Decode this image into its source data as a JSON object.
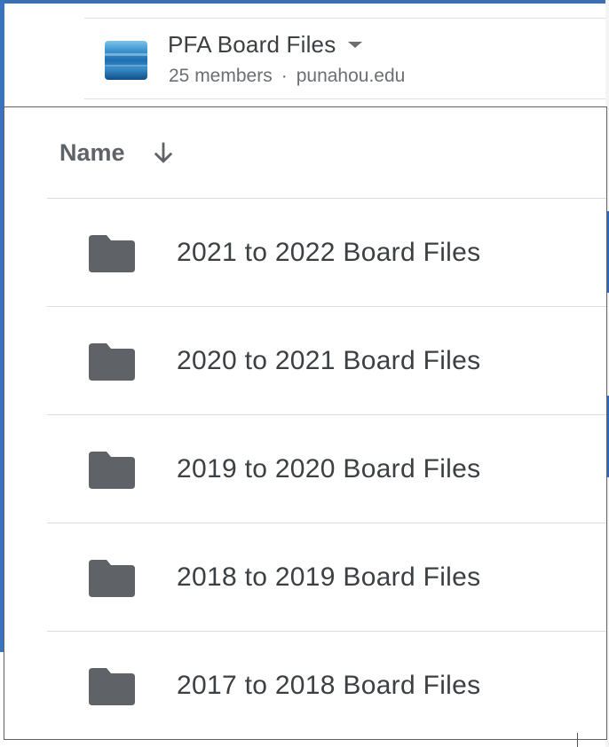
{
  "drive": {
    "name": "PFA Board Files",
    "members": "25 members",
    "separator": "·",
    "domain": "punahou.edu"
  },
  "list": {
    "sort_column": "Name",
    "sort_direction_icon": "arrow-down-icon",
    "rows": [
      {
        "label": "2021 to 2022 Board Files",
        "icon": "folder-icon"
      },
      {
        "label": "2020 to 2021 Board Files",
        "icon": "folder-icon"
      },
      {
        "label": "2019 to 2020 Board Files",
        "icon": "folder-icon"
      },
      {
        "label": "2018 to 2019 Board Files",
        "icon": "folder-icon"
      },
      {
        "label": "2017 to 2018 Board Files",
        "icon": "folder-icon"
      }
    ]
  },
  "colors": {
    "folder": "#5f6368",
    "text": "#3c4043",
    "divider": "#dadce0",
    "backdrop_blue": "#3a73c0"
  }
}
